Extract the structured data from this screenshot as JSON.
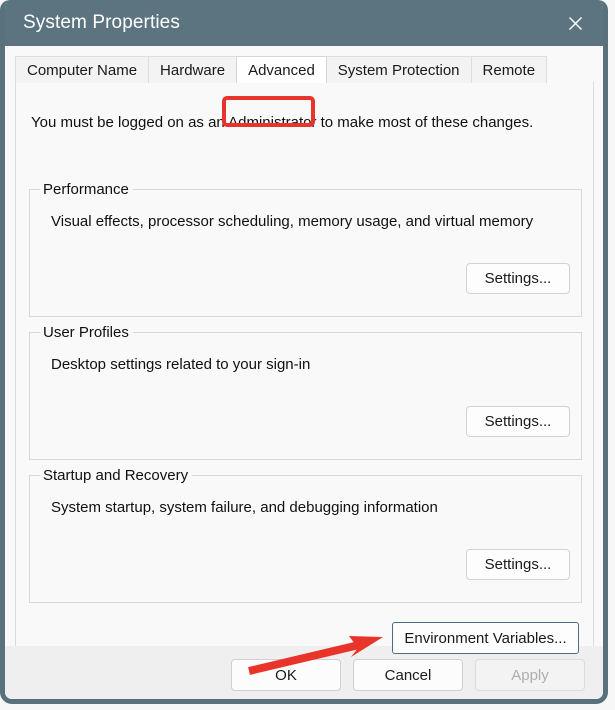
{
  "window": {
    "title": "System Properties",
    "close_icon": "close-icon"
  },
  "tabs": [
    {
      "label": "Computer Name",
      "selected": false
    },
    {
      "label": "Hardware",
      "selected": false
    },
    {
      "label": "Advanced",
      "selected": true
    },
    {
      "label": "System Protection",
      "selected": false
    },
    {
      "label": "Remote",
      "selected": false
    }
  ],
  "page": {
    "admin_note": "You must be logged on as an Administrator to make most of these changes.",
    "groups": [
      {
        "legend": "Performance",
        "description": "Visual effects, processor scheduling, memory usage, and virtual memory",
        "button_label": "Settings..."
      },
      {
        "legend": "User Profiles",
        "description": "Desktop settings related to your sign-in",
        "button_label": "Settings..."
      },
      {
        "legend": "Startup and Recovery",
        "description": "System startup, system failure, and debugging information",
        "button_label": "Settings..."
      }
    ],
    "environment_variables_label": "Environment Variables..."
  },
  "footer": {
    "ok_label": "OK",
    "cancel_label": "Cancel",
    "apply_label": "Apply",
    "apply_disabled": true
  },
  "annotations": {
    "tab_highlight_target": "Advanced",
    "arrow_target": "Environment Variables...",
    "accent_color": "#e8342a"
  },
  "colors": {
    "titlebar": "#5c7380",
    "content_bg": "#f9f9f9",
    "footer_bg": "#efefef",
    "focus_border": "#4a6d8c"
  }
}
